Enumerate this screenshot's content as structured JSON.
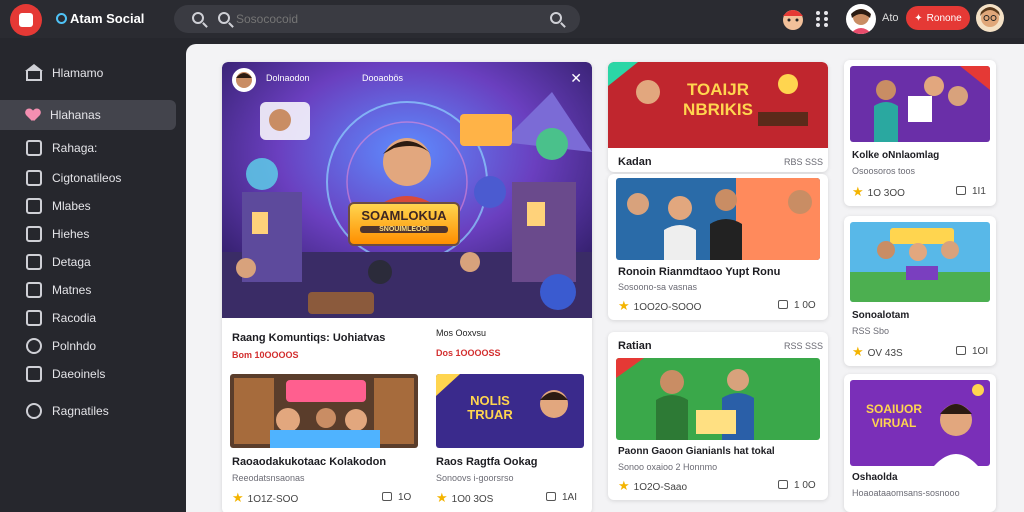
{
  "header": {
    "brand": "Atam Social",
    "search_placeholder": "Sosococoid",
    "small_label": "Ato",
    "live_button": "Ronone",
    "icons": [
      "app-logo",
      "search-icon",
      "grid-menu-icon",
      "avatar"
    ],
    "accent": "#e53935"
  },
  "sidebar": {
    "items": [
      {
        "label": "Hlamamo",
        "icon": "home-icon"
      },
      {
        "label": "Hlahanas",
        "icon": "heart-icon",
        "active": true
      },
      {
        "label": "Rahaga:",
        "icon": "page-icon"
      },
      {
        "label": "Cigtonatileos",
        "icon": "grid-icon"
      },
      {
        "label": "Mlabes",
        "icon": "box-icon"
      },
      {
        "label": "Hiehes",
        "icon": "page-icon"
      },
      {
        "label": "Detaga",
        "icon": "tag-icon"
      },
      {
        "label": "Matnes",
        "icon": "image-icon"
      },
      {
        "label": "Racodia",
        "icon": "edit-icon"
      },
      {
        "label": "Polnhdo",
        "icon": "bell-icon"
      },
      {
        "label": "Daeoinels",
        "icon": "folder-icon"
      },
      {
        "label": "Ragnatiles",
        "icon": "settings-icon"
      }
    ]
  },
  "feed": {
    "hero": {
      "channel": "Dolnaodon",
      "tag": "Dooaobös",
      "overlay_title": "SOAMLOKUA",
      "overlay_sub": "SNOUIMLEOOI",
      "title": "Raang Komuntiqs: Uohiatvas",
      "meta": "Bom 10OOOOS",
      "side_title": "Mos Ooxvsu",
      "side_meta": "Dos 1OOOOSS"
    },
    "cards": [
      {
        "id": "c1",
        "overlay": "TOAIJR NBRIKIS",
        "title": "Kadan",
        "meta": "RBS SSS"
      },
      {
        "id": "c2",
        "title": "Ronoin Rianmdtaoo Yupt Ronu",
        "meta": "Sosoono‑sa vasnas",
        "stars": "1OO2O‑SOOO",
        "likes": "1 0O"
      },
      {
        "id": "c3",
        "title": "Ratian",
        "meta": "RSS SSS",
        "title2": "Paonn Gaoon Gianianls hat tokal",
        "meta2": "Sonoo oxaioo 2 Honnmo",
        "stars": "1O2O‑Saao",
        "likes": "1 0O"
      },
      {
        "id": "c4",
        "title": "Kolke oNnlaomlag",
        "meta": "Osoosoros toos",
        "stars": "1O 3OO",
        "likes": "1I1"
      },
      {
        "id": "c5",
        "title": "Sonoalotam",
        "meta": "RSS Sbo",
        "stars": "OV 43S",
        "likes": "1OI"
      },
      {
        "id": "c6",
        "overlay": "SOAIUOR VIRUAL",
        "title": "Oshaolda",
        "meta": "Hoaoataaomsans‑sosnooo"
      },
      {
        "id": "c7",
        "overlay": "NOLIS TRUAR",
        "title": "Raos Ragtfa Ookag",
        "meta": "Sonoovs i‑goorsrso",
        "stars": "1O0 3OS",
        "likes": "1AI"
      },
      {
        "id": "c8",
        "title": "Raoaodakukotaac Kolakodon",
        "meta": "Reeodatsnsaonas",
        "stars": "1O1Z‑SOO",
        "likes": "1O"
      }
    ]
  }
}
